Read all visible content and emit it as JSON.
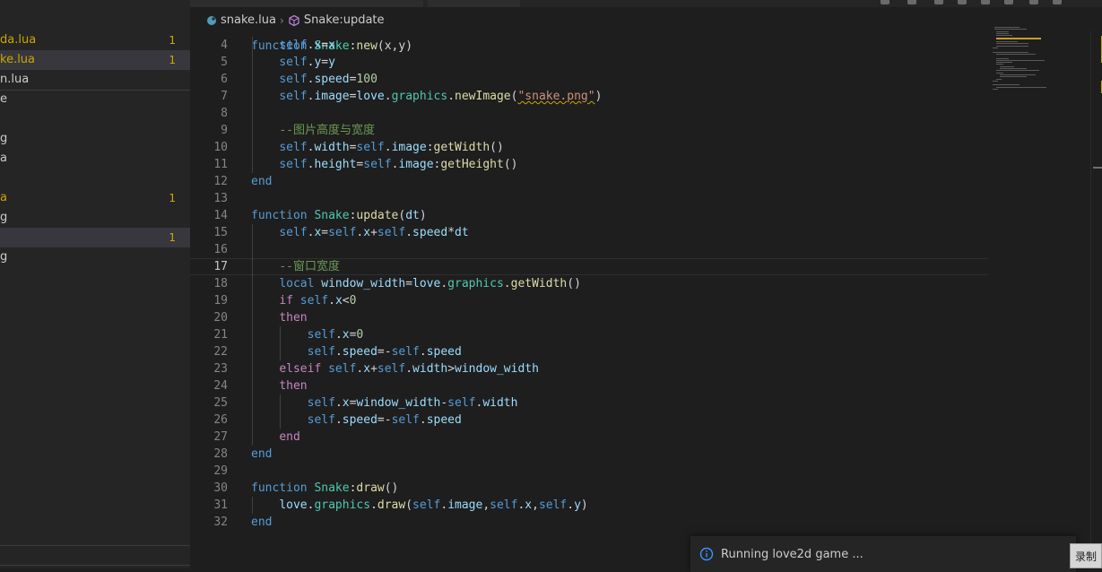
{
  "explorer": {
    "files": [
      {
        "name": "da.lua",
        "badge": "1",
        "state": "modified"
      },
      {
        "name": "ke.lua",
        "badge": "1",
        "state": "modified-selected"
      },
      {
        "name": "n.lua",
        "badge": "",
        "state": "plain"
      },
      {
        "name": "e",
        "badge": "",
        "state": "plain"
      },
      {
        "name": "g",
        "badge": "",
        "state": "plain"
      },
      {
        "name": "a",
        "badge": "",
        "state": "plain"
      },
      {
        "name": "a",
        "badge": "1",
        "state": "modified"
      },
      {
        "name": "g",
        "badge": "",
        "state": "plain"
      },
      {
        "name": "",
        "badge": "1",
        "state": "selected"
      },
      {
        "name": "g",
        "badge": "",
        "state": "plain"
      }
    ]
  },
  "breadcrumb": {
    "file": "snake.lua",
    "separator": "›",
    "symbol": "Snake:update"
  },
  "editor": {
    "active_line": "17",
    "lines": [
      {
        "n": "4",
        "t": [
          [
            "    ",
            ""
          ],
          [
            "self",
            "self"
          ],
          [
            ".",
            "op"
          ],
          [
            "x",
            "prop"
          ],
          [
            "=",
            "op"
          ],
          [
            "x",
            "prop"
          ]
        ]
      },
      {
        "n": "5",
        "t": [
          [
            "    ",
            ""
          ],
          [
            "self",
            "self"
          ],
          [
            ".",
            "op"
          ],
          [
            "y",
            "prop"
          ],
          [
            "=",
            "op"
          ],
          [
            "y",
            "prop"
          ]
        ]
      },
      {
        "n": "6",
        "t": [
          [
            "    ",
            ""
          ],
          [
            "self",
            "self"
          ],
          [
            ".",
            "op"
          ],
          [
            "speed",
            "prop"
          ],
          [
            "=",
            "op"
          ],
          [
            "100",
            "num"
          ]
        ]
      },
      {
        "n": "7",
        "t": [
          [
            "    ",
            ""
          ],
          [
            "self",
            "self"
          ],
          [
            ".",
            "op"
          ],
          [
            "image",
            "prop"
          ],
          [
            "=",
            "op"
          ],
          [
            "love",
            "prop"
          ],
          [
            ".",
            "op"
          ],
          [
            "graphics",
            "cls"
          ],
          [
            ".",
            "op"
          ],
          [
            "newImage",
            "fn"
          ],
          [
            "(",
            "op"
          ],
          [
            "\"snake.png\"",
            "str squig"
          ],
          [
            ")",
            "op"
          ]
        ]
      },
      {
        "n": "8",
        "t": []
      },
      {
        "n": "9",
        "t": [
          [
            "    ",
            ""
          ],
          [
            "--图片高度与宽度",
            "cm"
          ]
        ]
      },
      {
        "n": "10",
        "t": [
          [
            "    ",
            ""
          ],
          [
            "self",
            "self"
          ],
          [
            ".",
            "op"
          ],
          [
            "width",
            "prop"
          ],
          [
            "=",
            "op"
          ],
          [
            "self",
            "self"
          ],
          [
            ".",
            "op"
          ],
          [
            "image",
            "prop"
          ],
          [
            ":",
            "op"
          ],
          [
            "getWidth",
            "fn"
          ],
          [
            "()",
            "op"
          ]
        ]
      },
      {
        "n": "11",
        "t": [
          [
            "    ",
            ""
          ],
          [
            "self",
            "self"
          ],
          [
            ".",
            "op"
          ],
          [
            "height",
            "prop"
          ],
          [
            "=",
            "op"
          ],
          [
            "self",
            "self"
          ],
          [
            ".",
            "op"
          ],
          [
            "image",
            "prop"
          ],
          [
            ":",
            "op"
          ],
          [
            "getHeight",
            "fn"
          ],
          [
            "()",
            "op"
          ]
        ]
      },
      {
        "n": "12",
        "t": [
          [
            "end",
            "kw2"
          ]
        ]
      },
      {
        "n": "13",
        "t": []
      },
      {
        "n": "14",
        "t": [
          [
            "function",
            "kw2"
          ],
          [
            " ",
            "op"
          ],
          [
            "Snake",
            "cls"
          ],
          [
            ":",
            "op"
          ],
          [
            "update",
            "fn"
          ],
          [
            "(",
            "op"
          ],
          [
            "dt",
            "prop"
          ],
          [
            ")",
            "op"
          ]
        ]
      },
      {
        "n": "15",
        "t": [
          [
            "    ",
            ""
          ],
          [
            "self",
            "self"
          ],
          [
            ".",
            "op"
          ],
          [
            "x",
            "prop"
          ],
          [
            "=",
            "op"
          ],
          [
            "self",
            "self"
          ],
          [
            ".",
            "op"
          ],
          [
            "x",
            "prop"
          ],
          [
            "+",
            "op"
          ],
          [
            "self",
            "self"
          ],
          [
            ".",
            "op"
          ],
          [
            "speed",
            "prop"
          ],
          [
            "*",
            "op"
          ],
          [
            "dt",
            "prop"
          ]
        ]
      },
      {
        "n": "16",
        "t": []
      },
      {
        "n": "17",
        "t": [
          [
            "    ",
            ""
          ],
          [
            "--窗口宽度",
            "cm"
          ]
        ]
      },
      {
        "n": "18",
        "t": [
          [
            "    ",
            ""
          ],
          [
            "local",
            "kw2"
          ],
          [
            " ",
            "op"
          ],
          [
            "window_width",
            "prop"
          ],
          [
            "=",
            "op"
          ],
          [
            "love",
            "prop"
          ],
          [
            ".",
            "op"
          ],
          [
            "graphics",
            "cls"
          ],
          [
            ".",
            "op"
          ],
          [
            "getWidth",
            "fn"
          ],
          [
            "()",
            "op"
          ]
        ]
      },
      {
        "n": "19",
        "t": [
          [
            "    ",
            ""
          ],
          [
            "if",
            "kw"
          ],
          [
            " ",
            "op"
          ],
          [
            "self",
            "self"
          ],
          [
            ".",
            "op"
          ],
          [
            "x",
            "prop"
          ],
          [
            "<",
            "op"
          ],
          [
            "0",
            "num"
          ]
        ]
      },
      {
        "n": "20",
        "t": [
          [
            "    ",
            ""
          ],
          [
            "then",
            "kw"
          ]
        ]
      },
      {
        "n": "21",
        "t": [
          [
            "        ",
            ""
          ],
          [
            "self",
            "self"
          ],
          [
            ".",
            "op"
          ],
          [
            "x",
            "prop"
          ],
          [
            "=",
            "op"
          ],
          [
            "0",
            "num"
          ]
        ]
      },
      {
        "n": "22",
        "t": [
          [
            "        ",
            ""
          ],
          [
            "self",
            "self"
          ],
          [
            ".",
            "op"
          ],
          [
            "speed",
            "prop"
          ],
          [
            "=-",
            "op"
          ],
          [
            "self",
            "self"
          ],
          [
            ".",
            "op"
          ],
          [
            "speed",
            "prop"
          ]
        ]
      },
      {
        "n": "23",
        "t": [
          [
            "    ",
            ""
          ],
          [
            "elseif",
            "kw"
          ],
          [
            " ",
            "op"
          ],
          [
            "self",
            "self"
          ],
          [
            ".",
            "op"
          ],
          [
            "x",
            "prop"
          ],
          [
            "+",
            "op"
          ],
          [
            "self",
            "self"
          ],
          [
            ".",
            "op"
          ],
          [
            "width",
            "prop"
          ],
          [
            ">",
            "op"
          ],
          [
            "window_width",
            "prop"
          ]
        ]
      },
      {
        "n": "24",
        "t": [
          [
            "    ",
            ""
          ],
          [
            "then",
            "kw"
          ]
        ]
      },
      {
        "n": "25",
        "t": [
          [
            "        ",
            ""
          ],
          [
            "self",
            "self"
          ],
          [
            ".",
            "op"
          ],
          [
            "x",
            "prop"
          ],
          [
            "=",
            "op"
          ],
          [
            "window_width",
            "prop"
          ],
          [
            "-",
            "op"
          ],
          [
            "self",
            "self"
          ],
          [
            ".",
            "op"
          ],
          [
            "width",
            "prop"
          ]
        ]
      },
      {
        "n": "26",
        "t": [
          [
            "        ",
            ""
          ],
          [
            "self",
            "self"
          ],
          [
            ".",
            "op"
          ],
          [
            "speed",
            "prop"
          ],
          [
            "=-",
            "op"
          ],
          [
            "self",
            "self"
          ],
          [
            ".",
            "op"
          ],
          [
            "speed",
            "prop"
          ]
        ]
      },
      {
        "n": "27",
        "t": [
          [
            "    ",
            ""
          ],
          [
            "end",
            "kw"
          ]
        ]
      },
      {
        "n": "28",
        "t": [
          [
            "end",
            "kw2"
          ]
        ]
      },
      {
        "n": "29",
        "t": []
      },
      {
        "n": "30",
        "t": [
          [
            "function",
            "kw2"
          ],
          [
            " ",
            "op"
          ],
          [
            "Snake",
            "cls"
          ],
          [
            ":",
            "op"
          ],
          [
            "draw",
            "fn"
          ],
          [
            "()",
            "op"
          ]
        ]
      },
      {
        "n": "31",
        "t": [
          [
            "    ",
            ""
          ],
          [
            "love",
            "prop"
          ],
          [
            ".",
            "op"
          ],
          [
            "graphics",
            "cls"
          ],
          [
            ".",
            "op"
          ],
          [
            "draw",
            "fn"
          ],
          [
            "(",
            "op"
          ],
          [
            "self",
            "self"
          ],
          [
            ".",
            "op"
          ],
          [
            "image",
            "prop"
          ],
          [
            ",",
            "op"
          ],
          [
            "self",
            "self"
          ],
          [
            ".",
            "op"
          ],
          [
            "x",
            "prop"
          ],
          [
            ",",
            "op"
          ],
          [
            "self",
            "self"
          ],
          [
            ".",
            "op"
          ],
          [
            "y",
            "prop"
          ],
          [
            ")",
            "op"
          ]
        ]
      },
      {
        "n": "32",
        "t": [
          [
            "end",
            "kw2"
          ]
        ]
      }
    ]
  },
  "notification": {
    "icon": "info-icon",
    "message": "Running love2d game ..."
  },
  "recorder": {
    "label": "录制"
  },
  "colors": {
    "modified": "#cca700",
    "keyword": "#569cd6",
    "control": "#c586c0",
    "function": "#dcdcaa",
    "variable": "#9cdcfe",
    "string": "#ce9178",
    "number": "#b5cea8",
    "comment": "#6a9955",
    "type": "#4ec9b0"
  }
}
